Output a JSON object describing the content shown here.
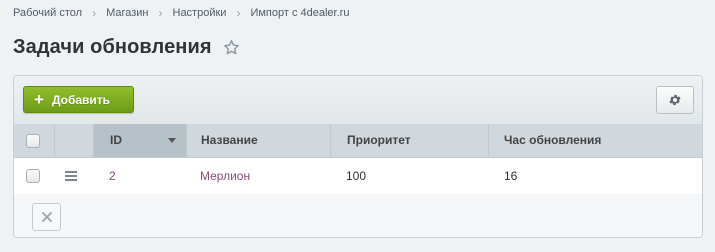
{
  "breadcrumb": {
    "items": [
      "Рабочий стол",
      "Магазин",
      "Настройки",
      "Импорт с 4dealer.ru"
    ]
  },
  "page": {
    "title": "Задачи обновления"
  },
  "toolbar": {
    "add_label": "Добавить"
  },
  "table": {
    "columns": [
      "ID",
      "Название",
      "Приоритет",
      "Час обновления"
    ],
    "sorted_column": "ID",
    "rows": [
      {
        "id": "2",
        "name": "Мерлион",
        "priority": "100",
        "hour": "16"
      }
    ]
  },
  "colors": {
    "accent_green": "#7aa71e",
    "link": "#80507c",
    "header_bg": "#d1d8dd"
  },
  "icons": {
    "favorite": "star-icon",
    "add": "plus-icon",
    "settings": "gear-icon",
    "row_menu": "hamburger-icon",
    "delete": "close-icon"
  }
}
